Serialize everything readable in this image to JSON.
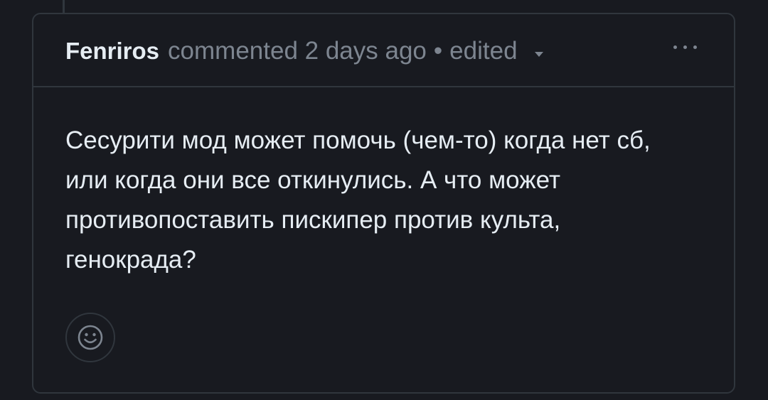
{
  "comment": {
    "author": "Fenriros",
    "action": "commented",
    "time": "2 days ago",
    "separator": "•",
    "edited_label": "edited",
    "body": "Сесурити мод может помочь (чем-то) когда нет сб, или когда они все откинулись. А что может противопоставить пискипер против культа, генокрада?"
  },
  "icons": {
    "more": "kebab-horizontal-icon",
    "edited_dropdown": "triangle-down-icon",
    "reaction": "smiley-icon"
  },
  "colors": {
    "background": "#181a20",
    "border": "#30363d",
    "text": "#e6edf3",
    "muted": "#7d8590"
  }
}
